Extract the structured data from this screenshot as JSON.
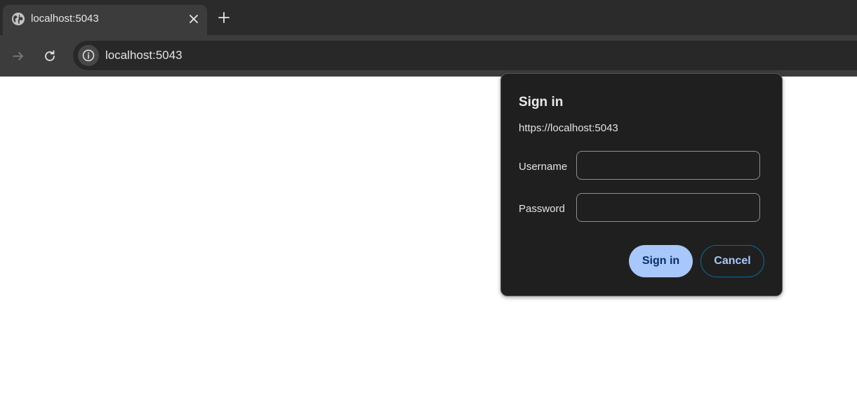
{
  "browser": {
    "tab": {
      "title": "localhost:5043",
      "favicon": "globe-icon",
      "close_icon": "close-icon"
    },
    "new_tab_icon": "plus-icon",
    "toolbar": {
      "forward_icon": "arrow-right-icon",
      "reload_icon": "reload-icon",
      "site_info_icon": "info-icon",
      "url": "localhost:5043"
    }
  },
  "dialog": {
    "title": "Sign in",
    "origin": "https://localhost:5043",
    "username_label": "Username",
    "username_value": "",
    "password_label": "Password",
    "password_value": "",
    "sign_in_label": "Sign in",
    "cancel_label": "Cancel"
  },
  "colors": {
    "accent": "#a8c7fa",
    "dialog_bg": "#1f1f1f",
    "toolbar_bg": "#3c3c3c"
  }
}
